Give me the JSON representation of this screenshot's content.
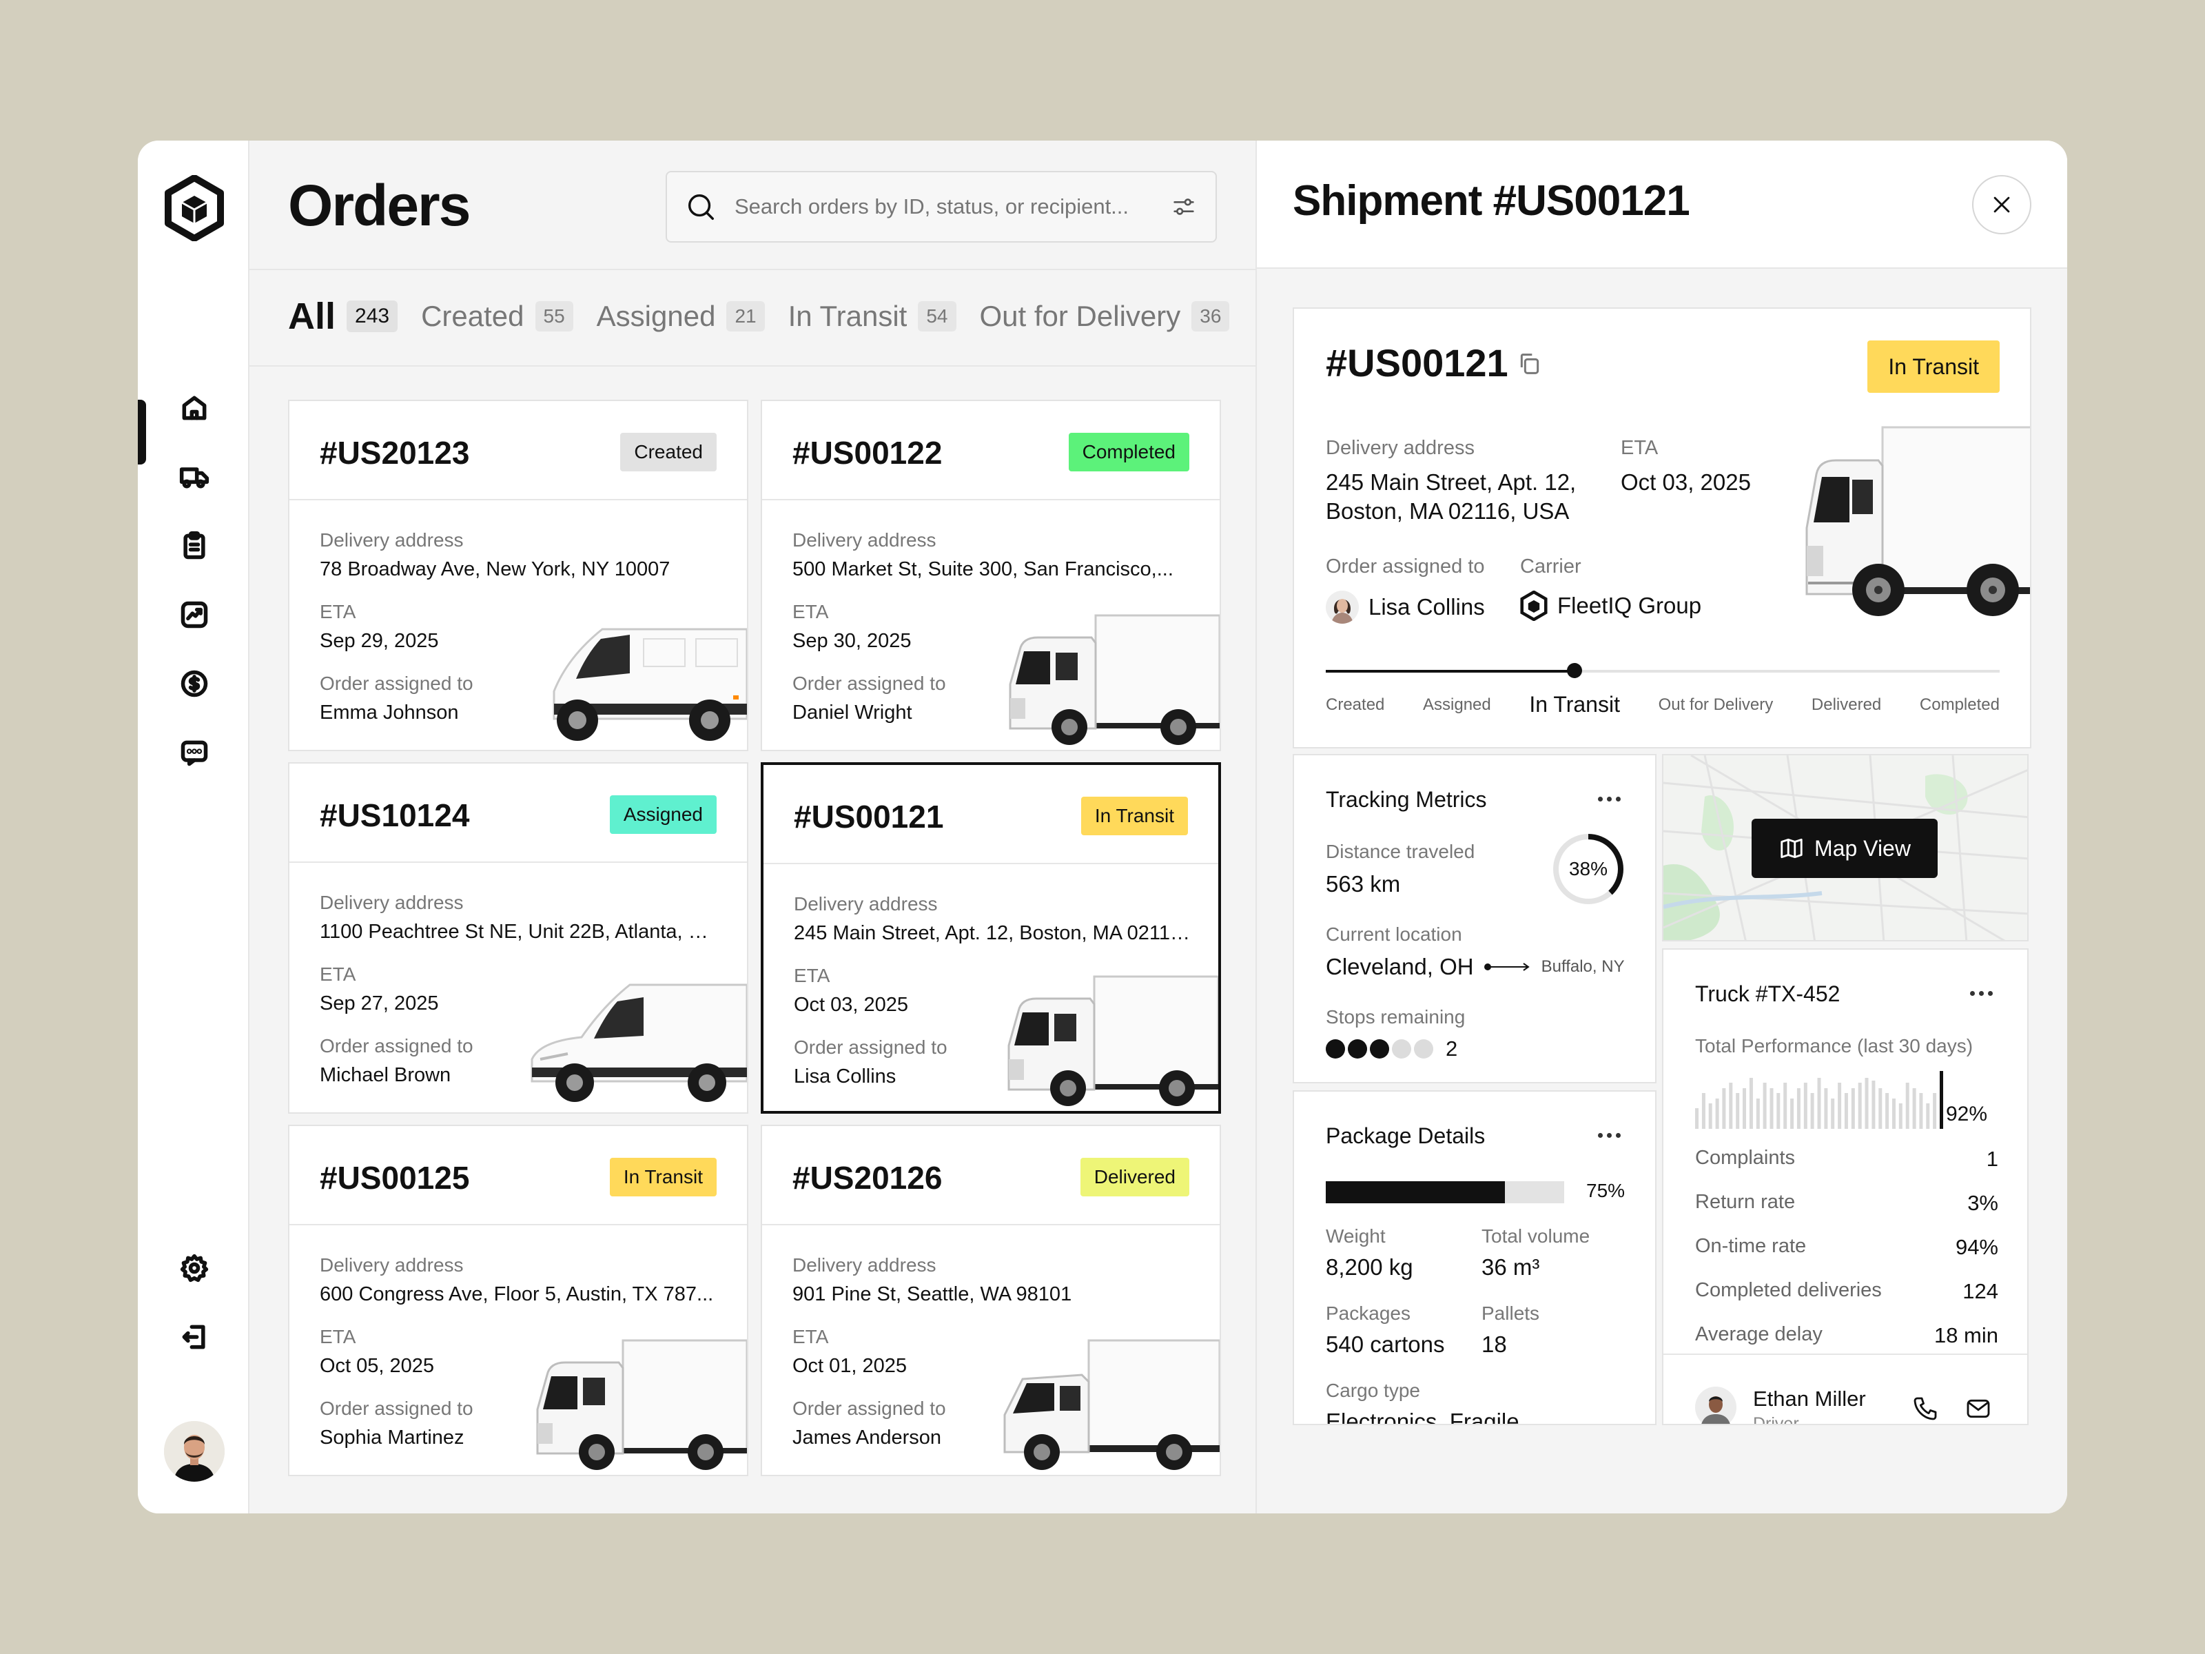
{
  "orders": {
    "title": "Orders",
    "search_placeholder": "Search orders by ID, status, or recipient...",
    "tabs": [
      {
        "label": "All",
        "count": "243"
      },
      {
        "label": "Created",
        "count": "55"
      },
      {
        "label": "Assigned",
        "count": "21"
      },
      {
        "label": "In Transit",
        "count": "54"
      },
      {
        "label": "Out for Delivery",
        "count": "36"
      }
    ],
    "field_labels": {
      "address": "Delivery address",
      "eta": "ETA",
      "assigned": "Order assigned to"
    },
    "cards": [
      {
        "id": "#US20123",
        "status": "Created",
        "badge_color": "#e2e2e2",
        "address": "78 Broadway Ave, New York, NY 10007",
        "eta": "Sep 29, 2025",
        "assignee": "Emma Johnson",
        "vehicle": "van"
      },
      {
        "id": "#US00122",
        "status": "Completed",
        "badge_color": "#5cf27a",
        "address": "500 Market St, Suite 300, San Francisco,...",
        "eta": "Sep 30, 2025",
        "assignee": "Daniel Wright",
        "vehicle": "truck"
      },
      {
        "id": "#US10124",
        "status": "Assigned",
        "badge_color": "#5ff0cf",
        "address": "1100 Peachtree St NE, Unit 22B, Atlanta, G...",
        "eta": "Sep 27, 2025",
        "assignee": "Michael Brown",
        "vehicle": "small-van"
      },
      {
        "id": "#US00121",
        "status": "In Transit",
        "badge_color": "#ffd95a",
        "address": "245 Main Street, Apt. 12, Boston, MA 02116...",
        "eta": "Oct 03, 2025",
        "assignee": "Lisa Collins",
        "vehicle": "truck"
      },
      {
        "id": "#US00125",
        "status": "In Transit",
        "badge_color": "#ffd95a",
        "address": "600 Congress Ave, Floor 5, Austin, TX 787...",
        "eta": "Oct 05, 2025",
        "assignee": "Sophia Martinez",
        "vehicle": "truck"
      },
      {
        "id": "#US20126",
        "status": "Delivered",
        "badge_color": "#eef577",
        "address": "901 Pine St, Seattle, WA 98101",
        "eta": "Oct 01, 2025",
        "assignee": "James Anderson",
        "vehicle": "box-truck"
      }
    ]
  },
  "detail": {
    "title": "Shipment #US00121",
    "id": "#US00121",
    "status": "In Transit",
    "status_color": "#ffd95a",
    "address_label": "Delivery address",
    "address_line1": "245 Main Street, Apt. 12,",
    "address_line2": "Boston, MA 02116, USA",
    "eta_label": "ETA",
    "eta": "Oct 03, 2025",
    "assigned_label": "Order assigned to",
    "assignee": "Lisa Collins",
    "carrier_label": "Carrier",
    "carrier": "FleetIQ Group",
    "progress_steps": [
      "Created",
      "Assigned",
      "In Transit",
      "Out for Delivery",
      "Delivered",
      "Completed"
    ],
    "current_step": 2,
    "tracking": {
      "title": "Tracking Metrics",
      "distance_label": "Distance traveled",
      "distance": "563 km",
      "percent": 38,
      "percent_label": "38%",
      "location_label": "Current location",
      "location": "Cleveland, OH",
      "destination": "Buffalo, NY",
      "stops_label": "Stops remaining",
      "stops_total": 5,
      "stops_done": 3,
      "stops_remaining": "2"
    },
    "map": {
      "button": "Map View"
    },
    "package": {
      "title": "Package Details",
      "fill_percent": 75,
      "fill_label": "75%",
      "weight_label": "Weight",
      "weight": "8,200 kg",
      "volume_label": "Total volume",
      "volume": "36 m³",
      "packages_label": "Packages",
      "packages": "540 cartons",
      "pallets_label": "Pallets",
      "pallets": "18",
      "cargo_label": "Cargo type",
      "cargo": "Electronics, Fragile"
    },
    "truck": {
      "title": "Truck #TX-452",
      "perf_label": "Total Performance (last 30 days)",
      "perf_value": "92%",
      "bars": [
        0.4,
        0.7,
        0.5,
        0.6,
        0.8,
        0.9,
        0.7,
        0.8,
        1.0,
        0.6,
        0.9,
        0.8,
        0.7,
        0.9,
        0.6,
        0.8,
        0.9,
        0.7,
        1.0,
        0.8,
        0.6,
        0.9,
        0.7,
        0.8,
        0.9,
        1.0,
        0.95,
        0.8,
        0.7,
        0.6,
        0.5,
        0.9,
        0.8,
        0.7,
        0.5,
        0.7,
        1.0
      ],
      "metrics": [
        {
          "label": "Complaints",
          "value": "1"
        },
        {
          "label": "Return rate",
          "value": "3%"
        },
        {
          "label": "On-time rate",
          "value": "94%"
        },
        {
          "label": "Completed deliveries",
          "value": "124"
        },
        {
          "label": "Average delay",
          "value": "18 min"
        }
      ],
      "driver_name": "Ethan Miller",
      "driver_role": "Driver"
    }
  }
}
